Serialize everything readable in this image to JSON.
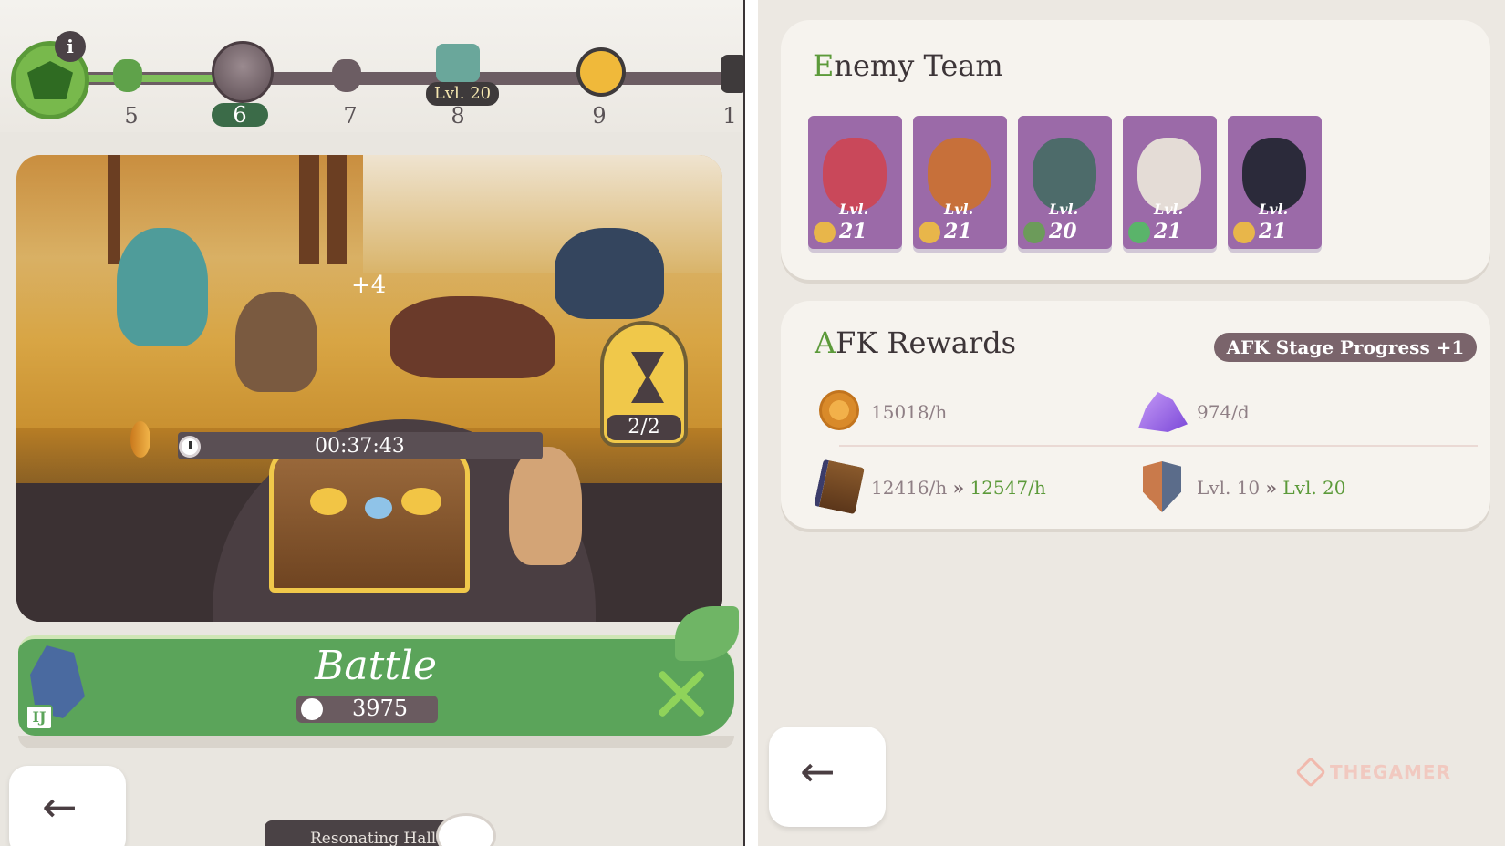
{
  "stage_track": {
    "stages": [
      "5",
      "6",
      "7",
      "8",
      "9",
      "1"
    ],
    "current_stage": "6",
    "chest_level_tag": "Lvl. 20",
    "info_label": "i"
  },
  "scene": {
    "chest_bonus": "+4",
    "timer": "00:37:43",
    "hourglass_count": "2/2"
  },
  "battle": {
    "label": "Battle",
    "power": "3975",
    "hero_badge": "IJ"
  },
  "bottom_nav": {
    "resonating_hall": "Resonating Hall"
  },
  "enemy_team": {
    "title_cap": "E",
    "title_rest": "nemy Team",
    "heroes": [
      {
        "lvl_prefix": "Lvl.",
        "level": "21",
        "color": "#c9485a",
        "class_color": "#e8b64a"
      },
      {
        "lvl_prefix": "Lvl.",
        "level": "21",
        "color": "#c7703a",
        "class_color": "#e8b64a"
      },
      {
        "lvl_prefix": "Lvl.",
        "level": "20",
        "color": "#4d6b6a",
        "class_color": "#6c9b5a"
      },
      {
        "lvl_prefix": "Lvl.",
        "level": "21",
        "color": "#e4dcd6",
        "class_color": "#5ab46a"
      },
      {
        "lvl_prefix": "Lvl.",
        "level": "21",
        "color": "#2b2a3a",
        "class_color": "#e8b64a"
      }
    ]
  },
  "afk_rewards": {
    "title_cap": "A",
    "title_rest": "FK Rewards",
    "badge": "AFK Stage Progress +1",
    "gold_rate": "15018/h",
    "crystal_rate": "974/d",
    "exp_from": "12416/h",
    "exp_to": "12547/h",
    "level_from": "Lvl. 10",
    "level_to": "Lvl. 20",
    "arrow": "»"
  },
  "back_arrow": "←",
  "watermark": "THEGAMER"
}
